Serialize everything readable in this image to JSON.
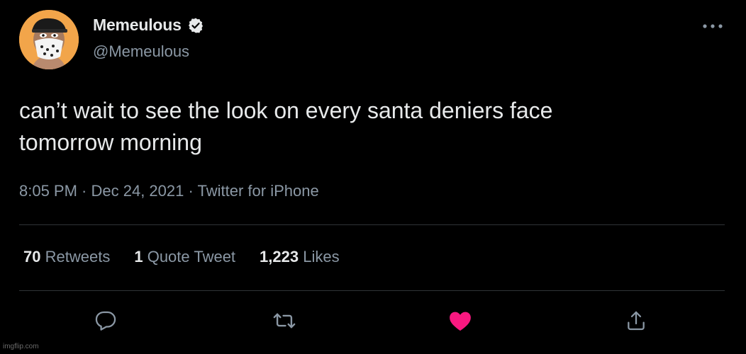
{
  "author": {
    "display_name": "Memeulous",
    "handle": "@Memeulous",
    "verified": true,
    "avatar_icon": "bored-ape-bandana-avatar"
  },
  "tweet": {
    "text_lines": [
      "can’t wait to see the look on every santa deniers face",
      "tomorrow morning"
    ],
    "meta": "8:05 PM · Dec 24, 2021 · Twitter for iPhone"
  },
  "stats": {
    "retweets": {
      "count": "70",
      "label": "Retweets"
    },
    "quotes": {
      "count": "1",
      "label": "Quote Tweet"
    },
    "likes": {
      "count": "1,223",
      "label": "Likes"
    }
  },
  "actions": [
    "reply-icon",
    "retweet-icon",
    "like-icon",
    "share-icon"
  ],
  "colors": {
    "background": "#000000",
    "text": "#e7e9ea",
    "secondary_text": "#8b98a5",
    "like_active": "#f91880",
    "avatar_bg": "#f2a54a"
  },
  "watermark": "imgflip.com"
}
